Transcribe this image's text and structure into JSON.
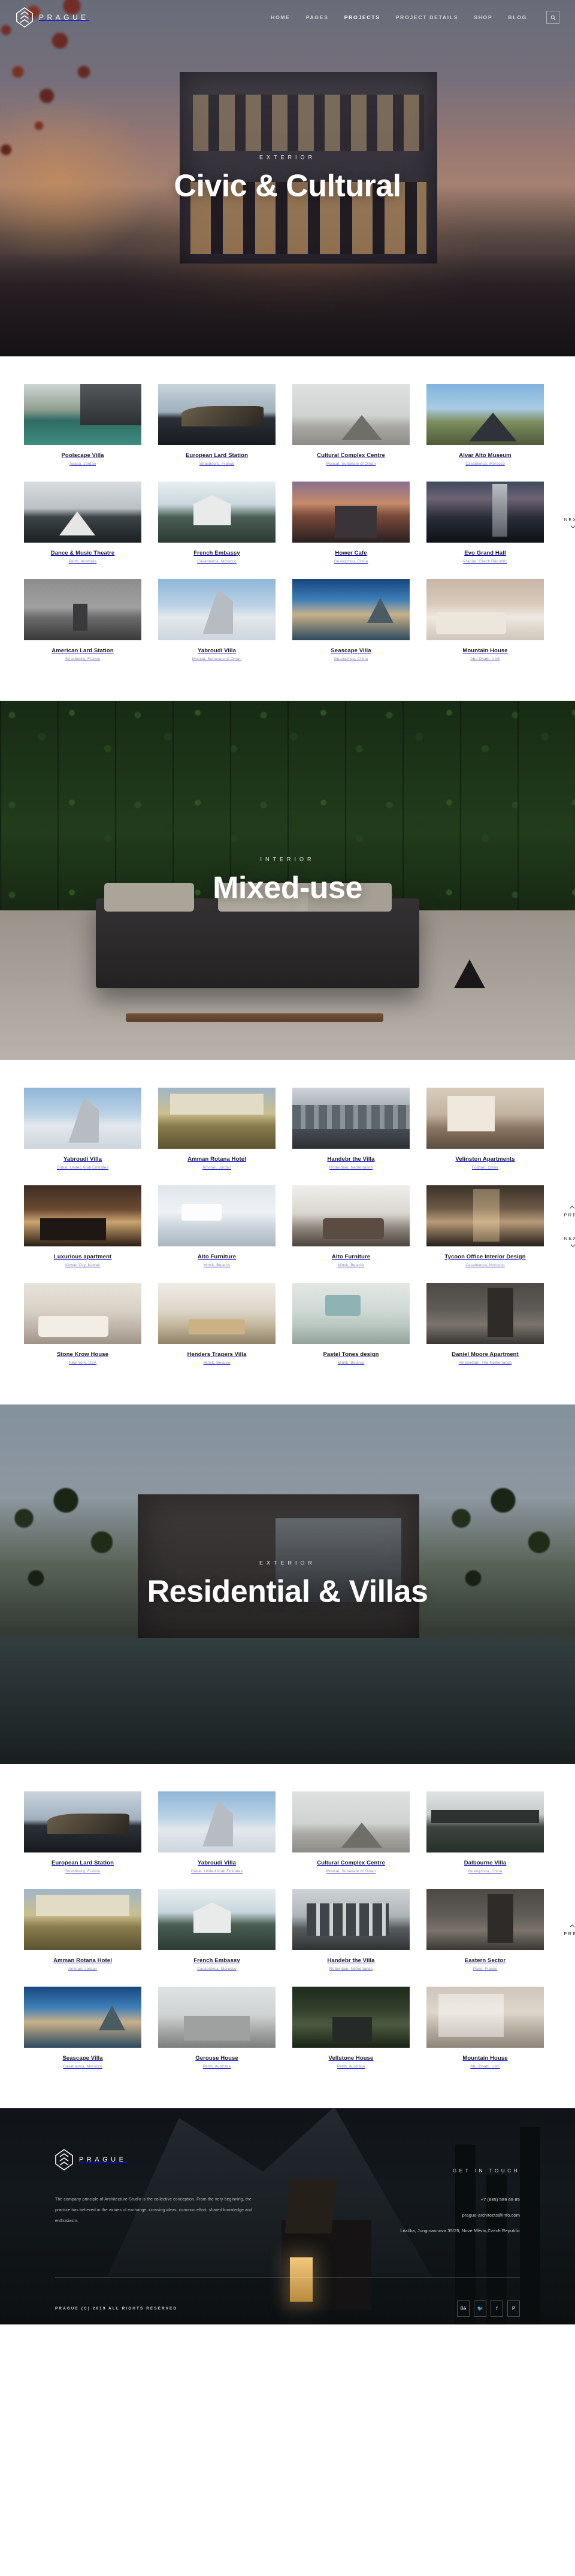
{
  "header": {
    "brand": "PRAGUE",
    "logo_icon": "diamond-chevron-logo",
    "nav": [
      {
        "label": "HOME",
        "active": false
      },
      {
        "label": "PAGES",
        "active": false
      },
      {
        "label": "PROJECTS",
        "active": true
      },
      {
        "label": "PROJECT DETAILS",
        "active": false
      },
      {
        "label": "SHOP",
        "active": false
      },
      {
        "label": "BLOG",
        "active": false
      }
    ],
    "search_icon": "search-icon"
  },
  "heroes": [
    {
      "kicker": "EXTERIOR",
      "title": "Civic & Cultural"
    },
    {
      "kicker": "INTERIOR",
      "title": "Mixed-use"
    },
    {
      "kicker": "EXTERIOR",
      "title": "Residential & Villas"
    }
  ],
  "grid_nav": {
    "next_label": "NEXT",
    "prev_label": "PREV",
    "next_icon": "chevron-down-icon",
    "prev_icon": "chevron-up-icon",
    "scroll_top_icon": "chevron-up-icon"
  },
  "grids": [
    {
      "id": "civic-cultural",
      "rows": [
        [
          {
            "title": "Poolscape Villa",
            "location": "Aqaba, Jordan",
            "art": "t-pool"
          },
          {
            "title": "European Lard Station",
            "location": "Strasbourg, France",
            "art": "t-station"
          },
          {
            "title": "Cultural Complex Centre",
            "location": "Muscat, Sultanate of Oman",
            "art": "t-cultural"
          },
          {
            "title": "Alvar Alto Museum",
            "location": "Casablanca, Morocco",
            "art": "t-alvar"
          }
        ],
        [
          {
            "title": "Dance & Music Theatre",
            "location": "Perth, Australia",
            "art": "t-dance"
          },
          {
            "title": "French Embassy",
            "location": "Casablanca, Morocco",
            "art": "t-french"
          },
          {
            "title": "Hower Cafe",
            "location": "Guangzhou, China",
            "art": "t-hower"
          },
          {
            "title": "Evo Grand Hall",
            "location": "Prague, Czech Republic",
            "art": "t-evo"
          }
        ],
        [
          {
            "title": "American Lard Station",
            "location": "Strasbourg, France",
            "art": "t-amstation"
          },
          {
            "title": "Yabroudi Villa",
            "location": "Muscat, Sultanate of Oman",
            "art": "t-yabroudi"
          },
          {
            "title": "Seascape Villa",
            "location": "Guangzhou, China",
            "art": "t-seascape"
          },
          {
            "title": "Mountain House",
            "location": "Abu Dhabi, UAE",
            "art": "t-mountain"
          }
        ]
      ]
    },
    {
      "id": "mixed-use",
      "rows": [
        [
          {
            "title": "Yabroudi Villa",
            "location": "Dubai, United Arab Emirates",
            "art": "t-yabroudi"
          },
          {
            "title": "Amman Rotana Hotel",
            "location": "Amman, Jordan",
            "art": "t-amman"
          },
          {
            "title": "Handebr the Villa",
            "location": "Rotterdam, Netherlands",
            "art": "t-handebr"
          },
          {
            "title": "Velinston Apartments",
            "location": "Foshan, China",
            "art": "t-velinston"
          }
        ],
        [
          {
            "title": "Luxurious apartment",
            "location": "Kuwait City, Kuwait",
            "art": "t-lux"
          },
          {
            "title": "Alto Furniture",
            "location": "Minsk, Belarus",
            "art": "t-alto"
          },
          {
            "title": "Alto Furniture",
            "location": "Minsk, Belarus",
            "art": "t-alto2"
          },
          {
            "title": "Tycoon Office Interior Design",
            "location": "Casablanca, Morocco",
            "art": "t-tycoon"
          }
        ],
        [
          {
            "title": "Stone Krow House",
            "location": "New York, USA",
            "art": "t-stone"
          },
          {
            "title": "Henders Tragers Villa",
            "location": "Minsk, Belarus",
            "art": "t-henders"
          },
          {
            "title": "Pastel Tones design",
            "location": "Minsk, Belarus",
            "art": "t-pastel"
          },
          {
            "title": "Daniel Moore Apartment",
            "location": "Amsterdam, The Netherlands",
            "art": "t-daniel"
          }
        ]
      ]
    },
    {
      "id": "residential-villas",
      "rows": [
        [
          {
            "title": "European Lard Station",
            "location": "Strasbourg, France",
            "art": "t-station"
          },
          {
            "title": "Yabroudi Villa",
            "location": "Dubai, United Arab Emirates",
            "art": "t-yabroudi"
          },
          {
            "title": "Cultural Complex Centre",
            "location": "Muscat, Sultanate of Oman",
            "art": "t-cultural"
          },
          {
            "title": "Dalbourne Villa",
            "location": "Guangzhou, China",
            "art": "t-dalbourne"
          }
        ],
        [
          {
            "title": "Amman Rotana Hotel",
            "location": "Amman, Jordan",
            "art": "t-amman"
          },
          {
            "title": "French Embassy",
            "location": "Casablanca, Morocco",
            "art": "t-french"
          },
          {
            "title": "Handebr the Villa",
            "location": "Rotterdam, Netherlands",
            "art": "t-eastern"
          },
          {
            "title": "Eastern Sector",
            "location": "Paris, France",
            "art": "t-daniel"
          }
        ],
        [
          {
            "title": "Seascape Villa",
            "location": "Casablanca, Morocco",
            "art": "t-seascape"
          },
          {
            "title": "Gerouse House",
            "location": "Perth, Australia",
            "art": "t-gerouse"
          },
          {
            "title": "Vellstone House",
            "location": "Perth, Australia",
            "art": "t-vellstone"
          },
          {
            "title": "Mountain House",
            "location": "Abu Dhabi, UAE",
            "art": "t-mountain2"
          }
        ]
      ]
    }
  ],
  "footer": {
    "brand": "PRAGUE",
    "about": "The company principle of Architecture-Studio is the collective conception. From the very beginning, the practice has believed in the virtues of exchange, crossing ideas, common effort, shared knowledge and enthusiasm.",
    "get_in_touch_title": "GET IN TOUCH",
    "phone": "+7 (885) 589 69 85",
    "email": "prague-architects@info.com",
    "address": "Litačka, Jungmannova 35/29, Nové Město,Czech Republic",
    "copyright": "PRAGUE (C) 2019 ALL RIGHTS RESERVED",
    "socials": [
      {
        "name": "behance-icon",
        "glyph": "Bē"
      },
      {
        "name": "twitter-icon",
        "glyph": "🐦"
      },
      {
        "name": "facebook-icon",
        "glyph": "f"
      },
      {
        "name": "pinterest-icon",
        "glyph": "P"
      }
    ]
  }
}
